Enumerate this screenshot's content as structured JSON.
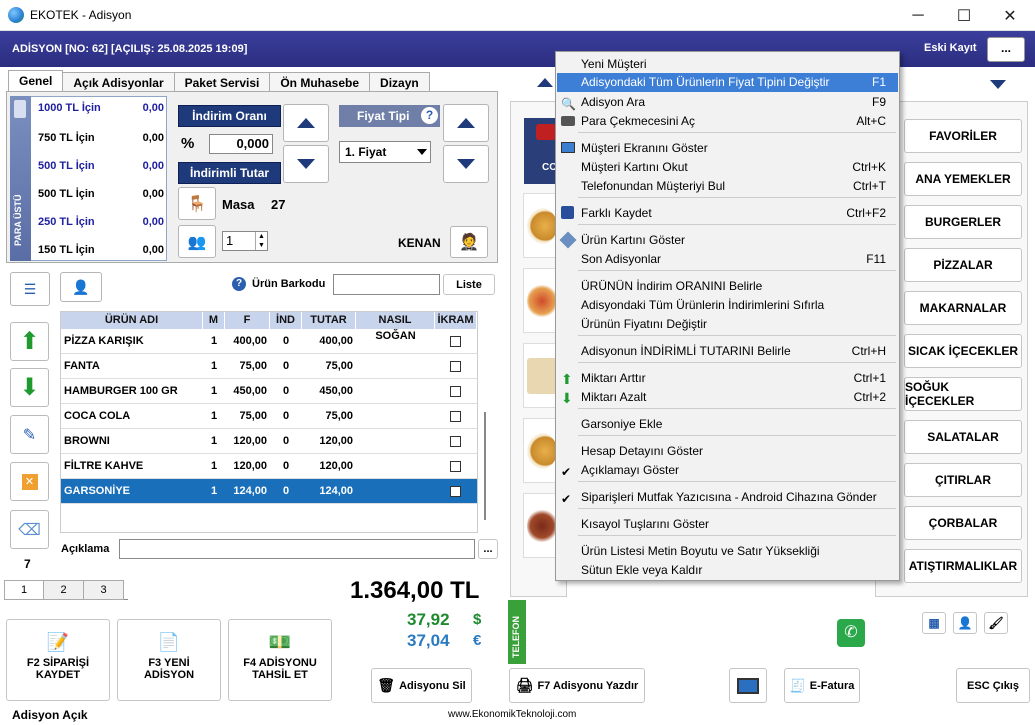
{
  "window": {
    "title": "EKOTEK - Adisyon",
    "minimize": "─",
    "maximize": "☐",
    "close": "✕"
  },
  "header": {
    "info": "ADİSYON [NO: 62] [AÇILIŞ: 25.08.2025 19:09]",
    "eski_kayit": "Eski Kayıt",
    "more": "..."
  },
  "tabs": [
    "Genel",
    "Açık Adisyonlar",
    "Paket Servisi",
    "Ön Muhasebe",
    "Dizayn"
  ],
  "para_ustu": {
    "label": "PARA ÜSTÜ",
    "rows": [
      {
        "label": "1000 TL İçin",
        "value": "0,00"
      },
      {
        "label": "750 TL İçin",
        "value": "0,00"
      },
      {
        "label": "500 TL İçin",
        "value": "0,00"
      },
      {
        "label": "500 TL İçin",
        "value": "0,00"
      },
      {
        "label": "250 TL İçin",
        "value": "0,00"
      },
      {
        "label": "150 TL İçin",
        "value": "0,00"
      }
    ]
  },
  "discount": {
    "rate_label": "İndirim Oranı",
    "percent": "%",
    "rate_value": "0,000",
    "discounted_label": "İndirimli Tutar"
  },
  "price_type": {
    "label": "Fiyat Tipi",
    "help": "?",
    "selected": "1. Fiyat"
  },
  "table": {
    "label": "Masa",
    "number": "27",
    "qty": "1"
  },
  "waiter": "KENAN",
  "barcode": {
    "help": "?",
    "label": "Ürün Barkodu",
    "value": "",
    "list_btn": "Liste"
  },
  "grid": {
    "headers": [
      "ÜRÜN ADI",
      "M",
      "F",
      "İND",
      "TUTAR",
      "NASIL",
      "İKRAM"
    ],
    "rows": [
      {
        "name": "PİZZA KARIŞIK",
        "m": "1",
        "f": "400,00",
        "ind": "0",
        "tutar": "400,00",
        "nasil": "SOĞAN"
      },
      {
        "name": "FANTA",
        "m": "1",
        "f": "75,00",
        "ind": "0",
        "tutar": "75,00",
        "nasil": ""
      },
      {
        "name": "HAMBURGER 100 GR",
        "m": "1",
        "f": "450,00",
        "ind": "0",
        "tutar": "450,00",
        "nasil": ""
      },
      {
        "name": "COCA COLA",
        "m": "1",
        "f": "75,00",
        "ind": "0",
        "tutar": "75,00",
        "nasil": ""
      },
      {
        "name": "BROWNI",
        "m": "1",
        "f": "120,00",
        "ind": "0",
        "tutar": "120,00",
        "nasil": ""
      },
      {
        "name": "FİLTRE KAHVE",
        "m": "1",
        "f": "120,00",
        "ind": "0",
        "tutar": "120,00",
        "nasil": ""
      },
      {
        "name": "GARSONİYE",
        "m": "1",
        "f": "124,00",
        "ind": "0",
        "tutar": "124,00",
        "nasil": ""
      }
    ]
  },
  "aciklama": {
    "label": "Açıklama",
    "value": "",
    "more": "..."
  },
  "left_count": "7",
  "pages": [
    "1",
    "2",
    "3"
  ],
  "totals": {
    "tl": "1.364,00 TL",
    "usd": "37,92",
    "usd_sym": "$",
    "eur": "37,04",
    "eur_sym": "€"
  },
  "telefon": "TELEFON",
  "buttons": {
    "f2": "F2 SİPARİŞİ KAYDET",
    "f3": "F3 YENİ ADİSYON",
    "f4": "F4 ADİSYONU TAHSİL ET",
    "sil": "Adisyonu Sil",
    "f7": "F7 Adisyonu Yazdır",
    "efatura": "E-Fatura",
    "esc": "ESC Çıkış"
  },
  "status": {
    "left": "Adisyon Açık",
    "website": "www.EkonomikTeknoloji.com"
  },
  "food_first_label": "CO",
  "categories": [
    "FAVORİLER",
    "ANA YEMEKLER",
    "BURGERLER",
    "PİZZALAR",
    "MAKARNALAR",
    "SICAK İÇECEKLER",
    "SOĞUK İÇECEKLER",
    "SALATALAR",
    "ÇITIRLAR",
    "ÇORBALAR",
    "ATIŞTIRMALIKLAR"
  ],
  "menu": {
    "items": [
      {
        "label": "Yeni Müşteri",
        "shortcut": "",
        "icon": ""
      },
      {
        "label": "Adisyondaki Tüm Ürünlerin Fiyat Tipini Değiştir",
        "shortcut": "F1",
        "icon": ""
      },
      {
        "label": "Adisyon Ara",
        "shortcut": "F9",
        "icon": "search-icon"
      },
      {
        "label": "Para Çekmecesini Aç",
        "shortcut": "Alt+C",
        "icon": "cash-drawer-icon"
      },
      {
        "label": "Müşteri Ekranını Göster",
        "shortcut": "",
        "icon": "monitor-icon"
      },
      {
        "label": "Müşteri Kartını Okut",
        "shortcut": "Ctrl+K",
        "icon": ""
      },
      {
        "label": "Telefonundan Müşteriyi Bul",
        "shortcut": "Ctrl+T",
        "icon": ""
      },
      {
        "label": "Farklı Kaydet",
        "shortcut": "Ctrl+F2",
        "icon": "save-icon"
      },
      {
        "label": "Ürün Kartını Göster",
        "shortcut": "",
        "icon": "card-icon"
      },
      {
        "label": "Son Adisyonlar",
        "shortcut": "F11",
        "icon": ""
      },
      {
        "label": "ÜRÜNÜN İndirim ORANINI Belirle",
        "shortcut": "",
        "icon": ""
      },
      {
        "label": "Adisyondaki Tüm Ürünlerin İndirimlerini Sıfırla",
        "shortcut": "",
        "icon": ""
      },
      {
        "label": "Ürünün Fiyatını Değiştir",
        "shortcut": "",
        "icon": ""
      },
      {
        "label": "Adisyonun İNDİRİMLİ TUTARINI Belirle",
        "shortcut": "Ctrl+H",
        "icon": ""
      },
      {
        "label": "Miktarı Arttır",
        "shortcut": "Ctrl+1",
        "icon": "arrow-up-icon"
      },
      {
        "label": "Miktarı Azalt",
        "shortcut": "Ctrl+2",
        "icon": "arrow-down-icon"
      },
      {
        "label": "Garsoniye Ekle",
        "shortcut": "",
        "icon": ""
      },
      {
        "label": "Hesap Detayını Göster",
        "shortcut": "",
        "icon": ""
      },
      {
        "label": "Açıklamayı Göster",
        "shortcut": "",
        "icon": "check-icon"
      },
      {
        "label": "Siparişleri Mutfak Yazıcısına - Android Cihazına Gönder",
        "shortcut": "",
        "icon": "check-icon"
      },
      {
        "label": "Kısayol Tuşlarını Göster",
        "shortcut": "",
        "icon": ""
      },
      {
        "label": "Ürün Listesi Metin Boyutu ve Satır Yüksekliği",
        "shortcut": "",
        "icon": ""
      },
      {
        "label": "Sütun Ekle veya Kaldır",
        "shortcut": "",
        "icon": ""
      }
    ]
  }
}
